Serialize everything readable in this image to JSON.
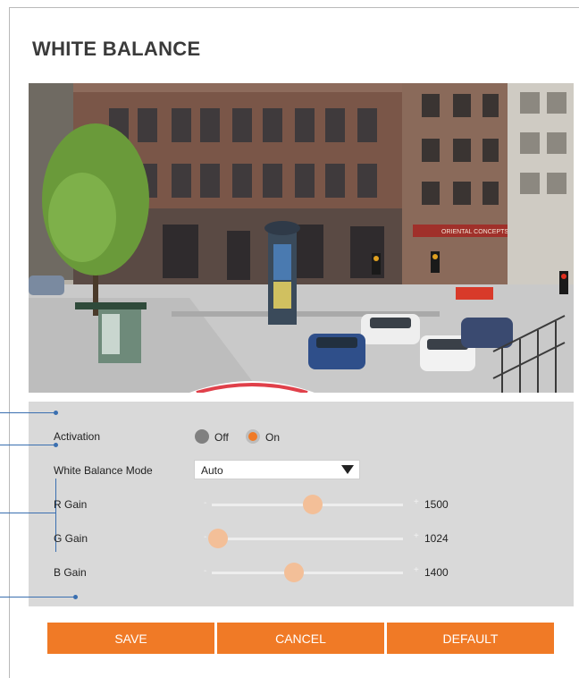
{
  "page": {
    "title": "WHITE BALANCE"
  },
  "camera": {
    "sign_text": "ORIENTAL CONCEPTS"
  },
  "activation": {
    "label": "Activation",
    "off_label": "Off",
    "on_label": "On",
    "selected": "On"
  },
  "mode": {
    "label": "White Balance Mode",
    "value": "Auto"
  },
  "sliders": [
    {
      "label": "R Gain",
      "value": "1500",
      "level": 0.52
    },
    {
      "label": "G Gain",
      "value": "1024",
      "level": 0.0
    },
    {
      "label": "B Gain",
      "value": "1400",
      "level": 0.42
    }
  ],
  "buttons": {
    "save": "SAVE",
    "cancel": "CANCEL",
    "default": "DEFAULT"
  },
  "colors": {
    "accent": "#f07a26",
    "thumb": "#f3bf98",
    "panel": "#d9d9d9",
    "callout": "#3a6fb0"
  }
}
